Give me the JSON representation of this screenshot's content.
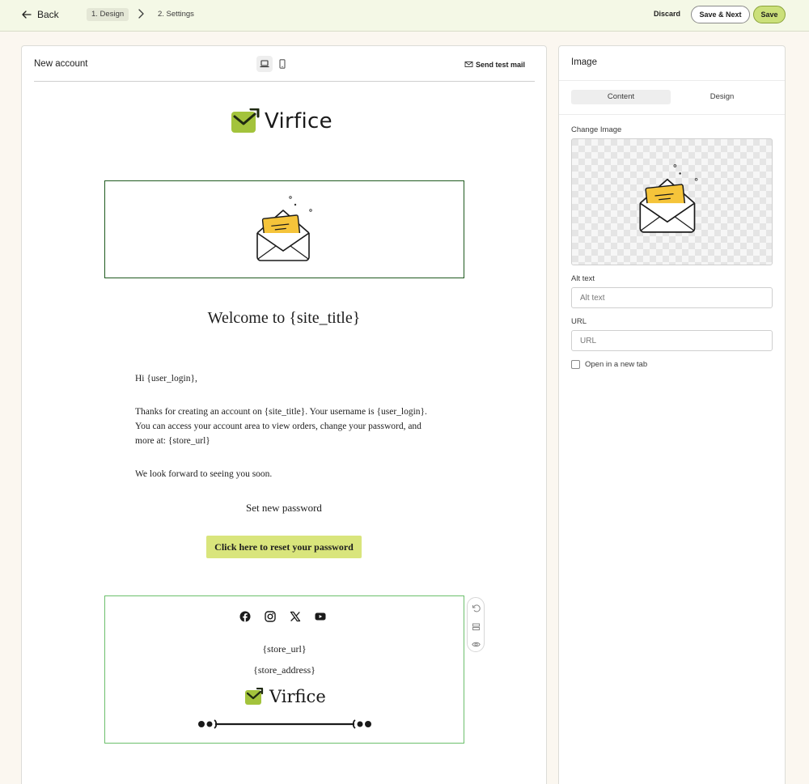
{
  "topbar": {
    "back_label": "Back",
    "steps": [
      "1. Design",
      "2. Settings"
    ],
    "discard_label": "Discard",
    "save_next_label": "Save & Next",
    "save_label": "Save"
  },
  "editor": {
    "title": "New account",
    "send_test_label": "Send test mail",
    "email": {
      "logo_text": "Virfice",
      "welcome_heading": "Welcome to {site_title}",
      "greeting": "Hi {user_login},",
      "paragraph": "Thanks for creating an account on {site_title}. Your username is {user_login}. You can access your account area to view orders, change your password, and more at: {store_url}",
      "closing": "We look forward to seeing you soon.",
      "set_password_heading": "Set new password",
      "reset_button_label": "Click here to reset your password",
      "footer": {
        "social_icons": [
          "facebook-icon",
          "instagram-icon",
          "x-icon",
          "youtube-icon"
        ],
        "store_url": "{store_url}",
        "store_address": "{store_address}",
        "logo_text": "Virfice"
      }
    }
  },
  "panel": {
    "title": "Image",
    "tabs": [
      "Content",
      "Design"
    ],
    "change_image_label": "Change Image",
    "alt_text_label": "Alt text",
    "alt_text_placeholder": "Alt text",
    "url_label": "URL",
    "url_placeholder": "URL",
    "open_new_tab_label": "Open in a new tab"
  },
  "colors": {
    "topbar_bg": "#f4f8e6",
    "accent": "#cbe07a",
    "button_accent": "#d9e57c",
    "selection_border": "#1f5a1f",
    "hover_border": "#6cbf6c"
  }
}
